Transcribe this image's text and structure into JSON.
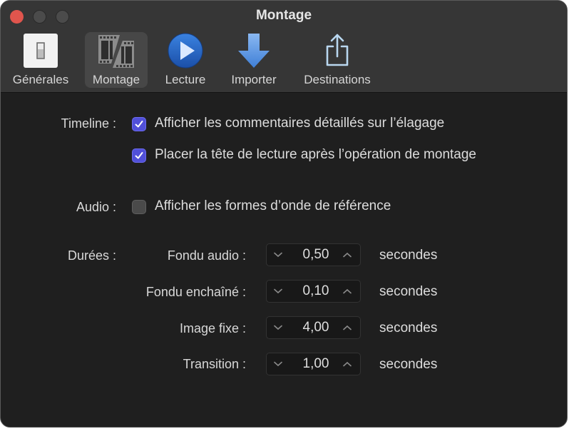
{
  "window": {
    "title": "Montage"
  },
  "toolbar": {
    "tabs": [
      {
        "label": "Générales",
        "icon": "switch-icon",
        "selected": false
      },
      {
        "label": "Montage",
        "icon": "film-edit-icon",
        "selected": true
      },
      {
        "label": "Lecture",
        "icon": "play-icon",
        "selected": false
      },
      {
        "label": "Importer",
        "icon": "import-arrow-icon",
        "selected": false
      },
      {
        "label": "Destinations",
        "icon": "share-icon",
        "selected": false
      }
    ]
  },
  "timeline": {
    "label": "Timeline :",
    "options": [
      {
        "label": "Afficher les commentaires détaillés sur l’élagage",
        "checked": true
      },
      {
        "label": "Placer la tête de lecture après l’opération de montage",
        "checked": true
      }
    ]
  },
  "audio": {
    "label": "Audio :",
    "options": [
      {
        "label": "Afficher les formes d’onde de référence",
        "checked": false
      }
    ]
  },
  "durations": {
    "label": "Durées :",
    "unit": "secondes",
    "items": [
      {
        "label": "Fondu audio :",
        "value": "0,50"
      },
      {
        "label": "Fondu enchaîné :",
        "value": "0,10"
      },
      {
        "label": "Image fixe :",
        "value": "4,00"
      },
      {
        "label": "Transition :",
        "value": "1,00"
      }
    ]
  },
  "colors": {
    "accent": "#5150d8",
    "toolbar_bg": "#363636",
    "content_bg": "#1f1f1f",
    "close_button": "#e0554d"
  }
}
